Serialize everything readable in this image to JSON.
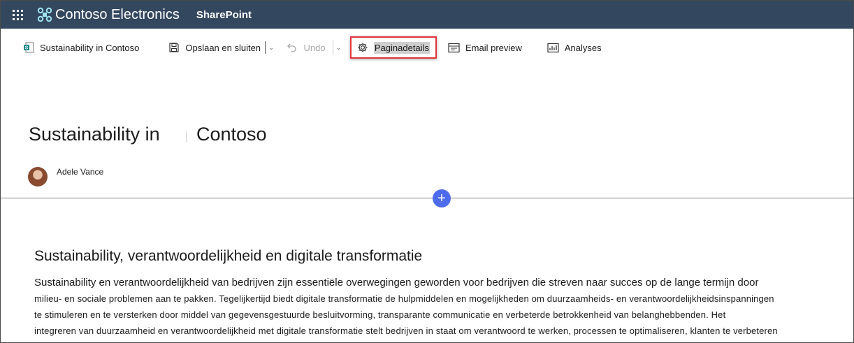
{
  "suitebar": {
    "brand": "Contoso Electronics",
    "app": "SharePoint"
  },
  "commandbar": {
    "page_name": "Sustainability in Contoso",
    "save_label": "Opslaan en sluiten",
    "undo_label": "Undo",
    "page_details_label": "Paginadetails",
    "email_preview_label": "Email preview",
    "analytics_label": "Analyses"
  },
  "page": {
    "title_part1": "Sustainability in",
    "title_part2": "Contoso",
    "author": "Adele Vance",
    "add_section": "+"
  },
  "article": {
    "heading": "Sustainability, verantwoordelijkheid en digitale transformatie",
    "lead": "Sustainability en verantwoordelijkheid van bedrijven zijn essentiële overwegingen geworden voor bedrijven die streven naar succes op de lange termijn door",
    "lines": [
      "milieu- en sociale problemen aan te pakken. Tegelijkertijd biedt digitale transformatie de hulpmiddelen en mogelijkheden om duurzaamheids- en verantwoordelijkheidsinspanningen",
      "te stimuleren en te versterken door middel van gegevensgestuurde besluitvorming, transparante communicatie en verbeterde betrokkenheid van belanghebbenden. Het",
      "integreren van duurzaamheid en verantwoordelijkheid met digitale transformatie stelt bedrijven in staat om verantwoord te werken, processen te optimaliseren, klanten te verbeteren"
    ]
  },
  "colors": {
    "suitebar": "#33475f",
    "highlight_border": "#e0353a",
    "add_button": "#4f6bed"
  },
  "icons": [
    "waffle-icon",
    "contoso-logo-icon",
    "sharepoint-page-icon",
    "save-icon",
    "undo-icon",
    "gear-icon",
    "email-icon",
    "analytics-icon",
    "plus-icon"
  ]
}
